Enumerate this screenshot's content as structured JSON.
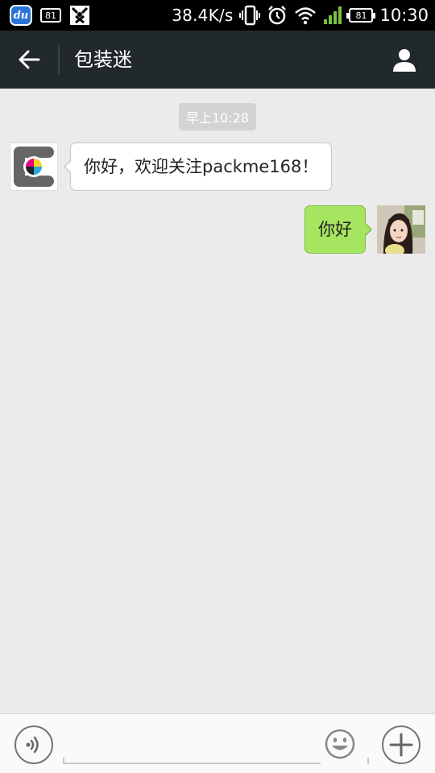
{
  "status_bar": {
    "badge_1": "81",
    "speed": "38.4K/s",
    "battery": "81",
    "time": "10:30",
    "icons": [
      "du-app-icon",
      "battery-small-icon",
      "cat-app-icon",
      "vibrate-icon",
      "alarm-icon",
      "wifi-icon",
      "signal-icon",
      "battery-icon"
    ],
    "signal_color": "#7ac142"
  },
  "header": {
    "title": "包装迷",
    "back_icon": "arrow-left-icon",
    "profile_icon": "person-icon"
  },
  "chat": {
    "timestamp": "早上10:28",
    "messages": [
      {
        "side": "left",
        "sender": "包装迷",
        "text": "你好，欢迎关注packme168！"
      },
      {
        "side": "right",
        "sender": "me",
        "text": "你好"
      }
    ],
    "colors": {
      "background": "#ebebeb",
      "incoming_bubble": "#ffffff",
      "outgoing_bubble": "#a6e55f"
    }
  },
  "input_bar": {
    "value": "",
    "placeholder": "",
    "voice_icon": "voice-icon",
    "emoji_icon": "emoji-icon",
    "plus_icon": "plus-icon"
  }
}
